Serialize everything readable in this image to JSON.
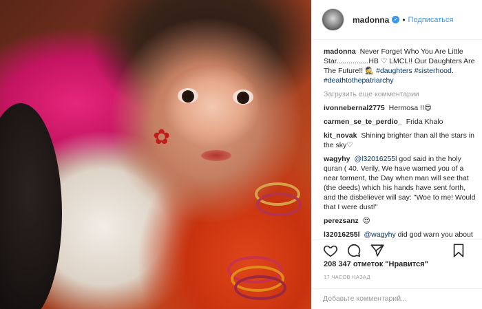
{
  "header": {
    "username": "madonna",
    "verified_glyph": "✓",
    "separator": "•",
    "follow_label": "Подписаться"
  },
  "caption": {
    "username": "madonna",
    "text": "Never Forget Who You Are Little Star................HB ♡ LMCL!! Our Daughters Are The Future!! 🕵",
    "tags": "#daughters",
    "tags2": "#sisterhood. #deathtothepatriarchy"
  },
  "load_more_label": "Загрузить еще комментарии",
  "comments": [
    {
      "user": "ivonnebernal2775",
      "text": "Hermosa !!😍"
    },
    {
      "user": "carmen_se_te_perdio_",
      "text": "Frida Khalo"
    },
    {
      "user": "kit_novak",
      "text": "Shining brighter than all the stars in the sky♡"
    },
    {
      "user": "wagyhy",
      "mention": "@l32016255l",
      "text": "god said in the holy quran ( 40. Verily, We have warned you of a near torment, the Day when man will see that (the deeds) which his hands have sent forth, and the disbeliever will say: \"Woe to me! Would that I were dust!\""
    },
    {
      "user": "perezsanz",
      "text": "😍"
    },
    {
      "user": "l32016255l",
      "mention": "@wagyhy",
      "text": "did god warn you about the dust between your anus hole"
    }
  ],
  "likes_text": "208 347 отметок \"Нравится\"",
  "time_text": "17 ЧАСОВ НАЗАД",
  "add_comment_placeholder": "Добавьте комментарий...",
  "icons": {
    "like": "heart-icon",
    "comment": "comment-icon",
    "share": "share-icon",
    "save": "bookmark-icon"
  },
  "colors": {
    "link": "#3897f0",
    "hashtag": "#003569",
    "muted": "#999999",
    "border": "#efefef"
  }
}
